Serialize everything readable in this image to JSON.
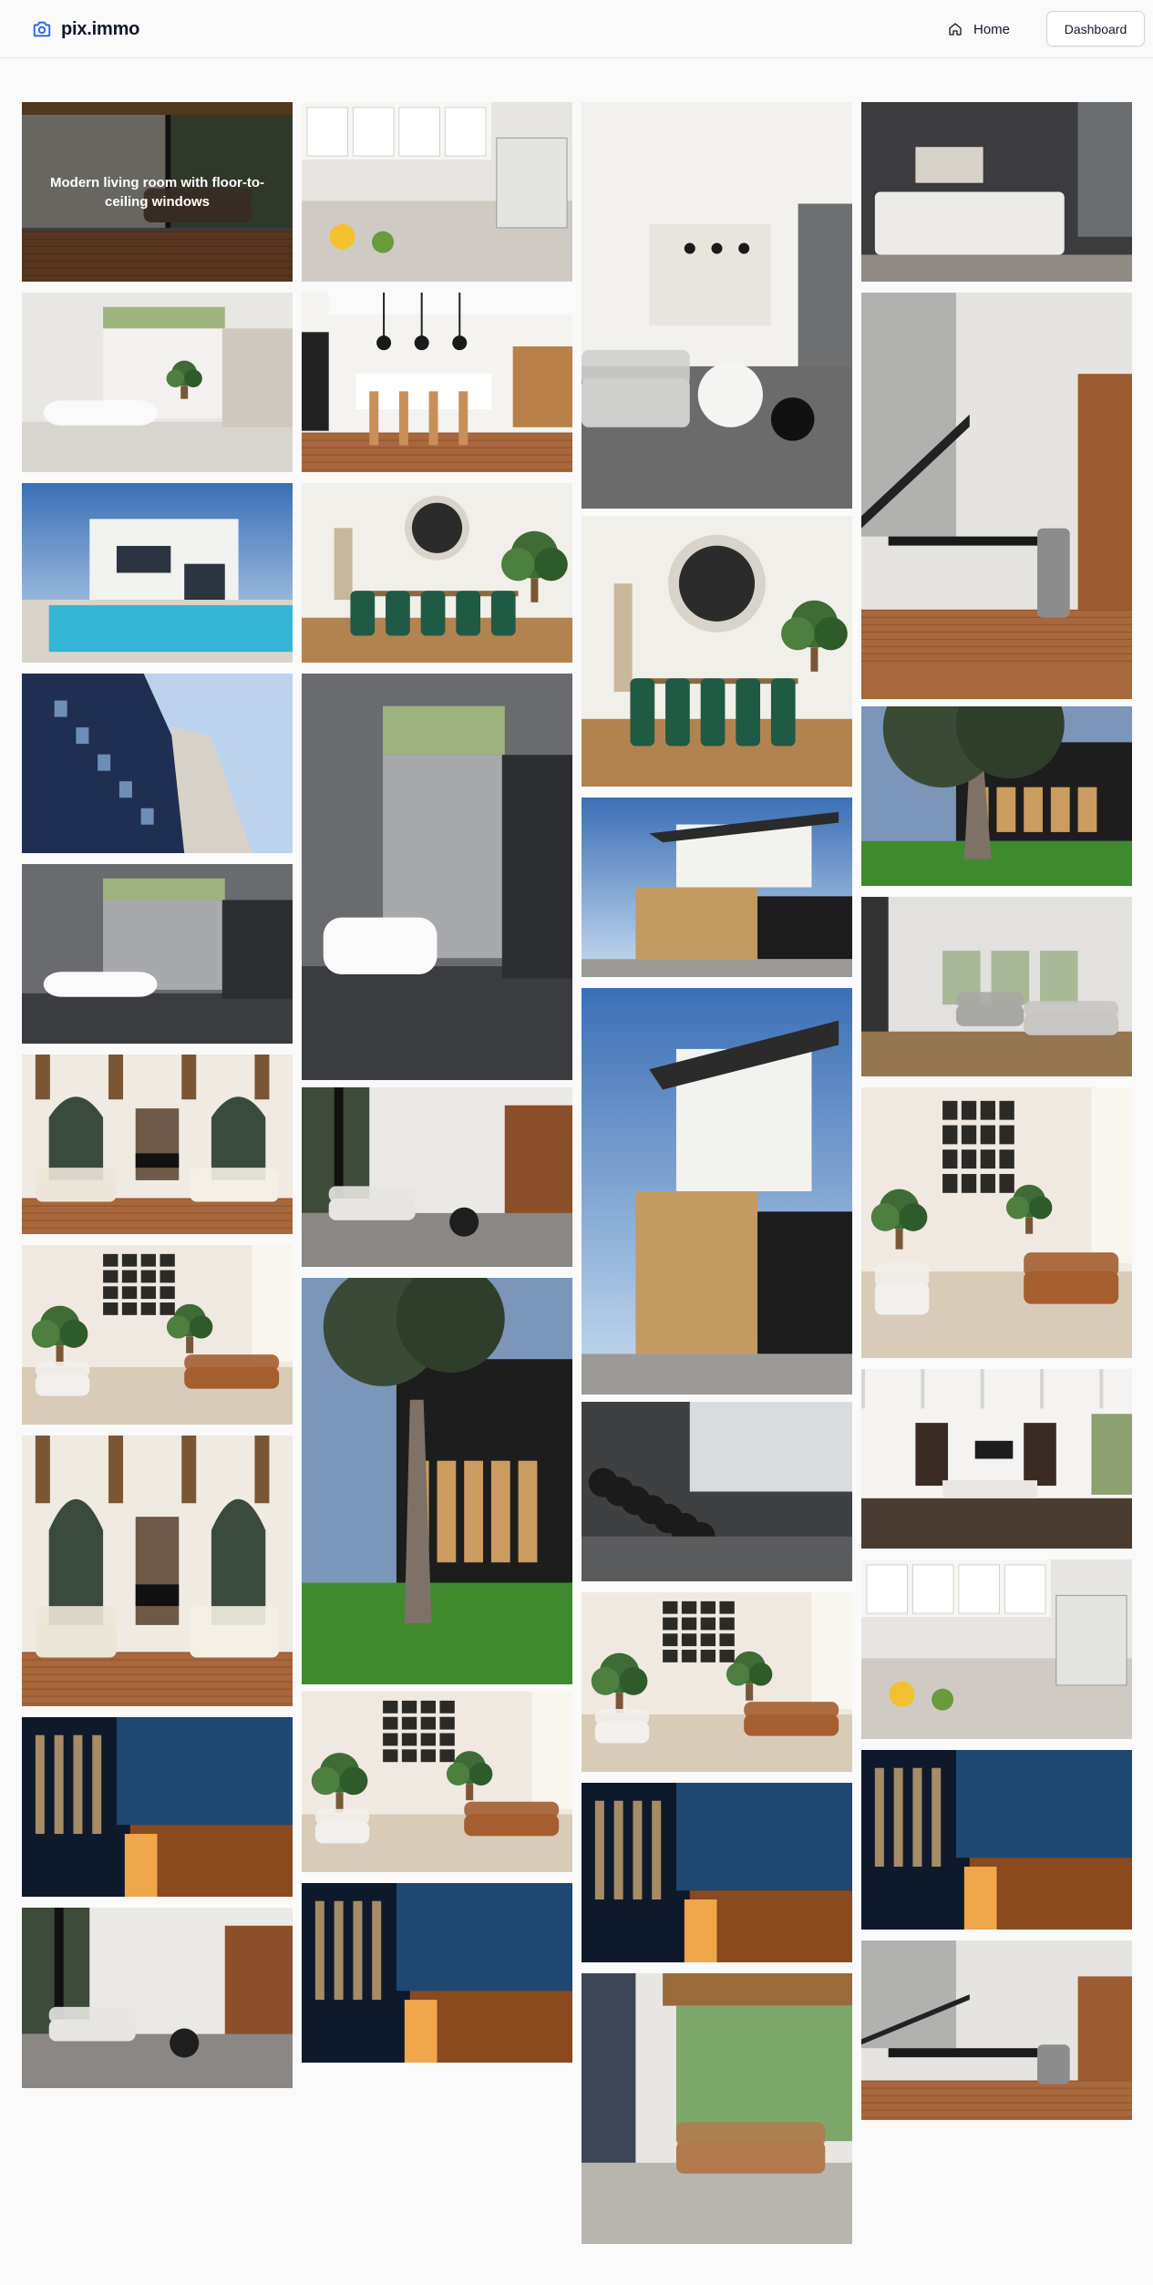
{
  "app": {
    "name": "pix.immo"
  },
  "nav": {
    "home_label": "Home",
    "dashboard_label": "Dashboard"
  },
  "gallery": {
    "hover_caption": "Modern living room with floor-to-ceiling windows",
    "columns": [
      [
        "living-room-hover",
        "bathroom-bright",
        "villa-pool",
        "apartment-facade",
        "bathroom-dark",
        "great-room-beams",
        "living-room-frames",
        "great-room-beams",
        "blue-facade-night",
        "living-room-wood"
      ],
      [
        "kitchen-white",
        "kitchen-island",
        "dining-green-chairs",
        "bathroom-tall",
        "living-room-wood",
        "modern-house-tree",
        "living-room-frames",
        "blue-facade-night"
      ],
      [
        "living-room-tall",
        "dining-green-chairs",
        "house-wood-cladding",
        "house-wood-tall",
        "gym",
        "living-room-frames",
        "blue-facade-night",
        "lounge-windows"
      ],
      [
        "bedroom",
        "dining-staircase",
        "modern-house-tree",
        "living-room-grey",
        "living-room-frames-tall",
        "living-room-coffered",
        "kitchen-counter",
        "blue-facade-night",
        "dining-staircase-small"
      ]
    ]
  },
  "colors": {
    "accent": "#2563eb",
    "background": "#fafafa",
    "border": "#e5e7eb"
  },
  "icons": {
    "logo": "camera-icon",
    "home": "home-icon"
  }
}
